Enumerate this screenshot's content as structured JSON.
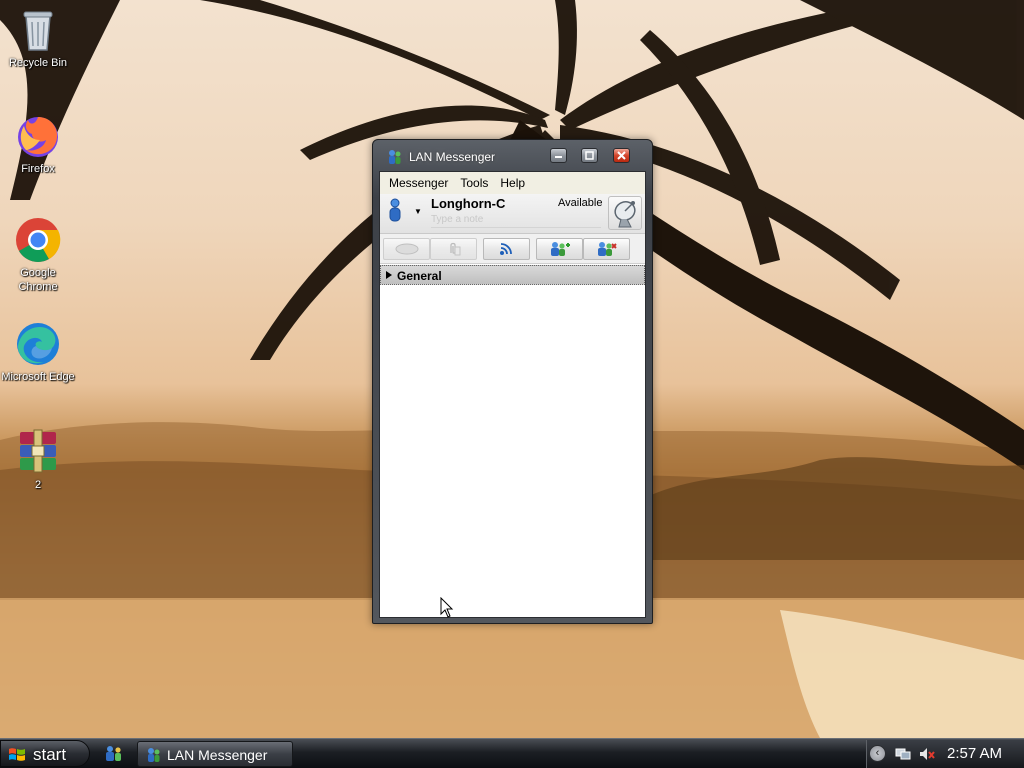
{
  "desktop": {
    "icons": [
      {
        "label": "Recycle Bin"
      },
      {
        "label": "Firefox"
      },
      {
        "label": "Google Chrome"
      },
      {
        "label": "Microsoft Edge"
      },
      {
        "label": "2"
      }
    ]
  },
  "window": {
    "title": "LAN Messenger",
    "menu": [
      "Messenger",
      "Tools",
      "Help"
    ],
    "profile": {
      "username": "Longhorn-C",
      "status": "Available",
      "note_placeholder": "Type a note"
    },
    "toolbar_icons": [
      "chat-icon",
      "file-transfer-icon",
      "broadcast-icon",
      "add-group-icon",
      "add-user-icon"
    ],
    "groups": [
      {
        "label": "General"
      }
    ]
  },
  "taskbar": {
    "start_label": "start",
    "task_label": "LAN Messenger",
    "clock": "2:57 AM"
  },
  "colors": {
    "accent": "#3a78d8",
    "close_red": "#d5462c"
  }
}
